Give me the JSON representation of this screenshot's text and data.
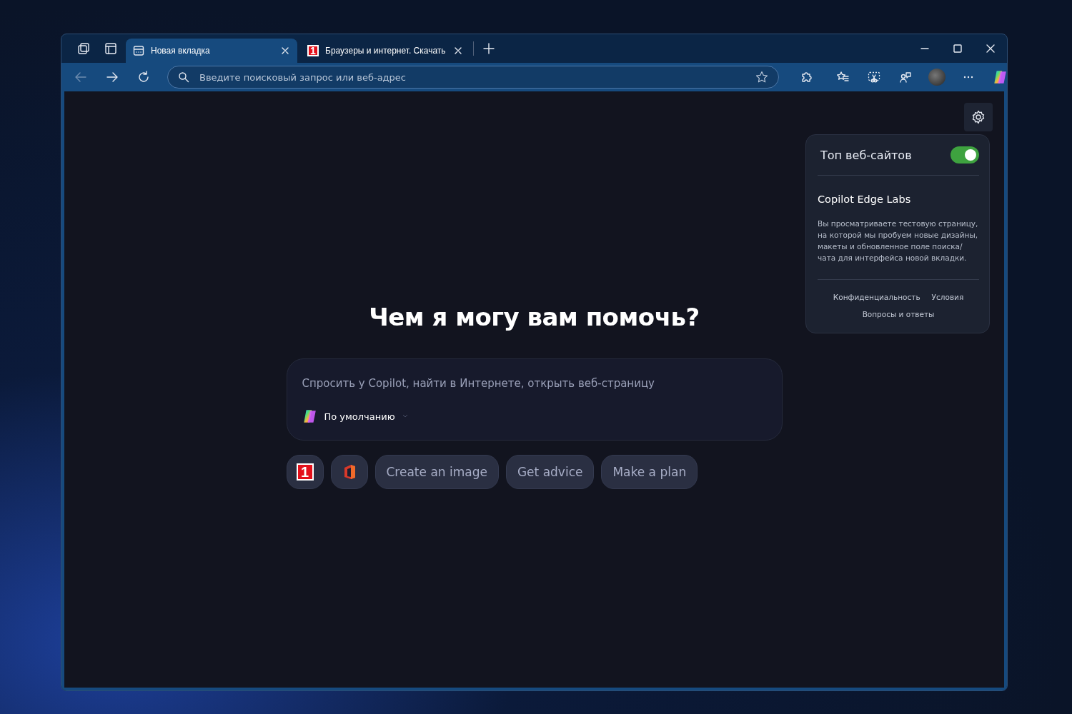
{
  "tabs": [
    {
      "kind": "newtab",
      "title": "Новая вкладка",
      "selected": true
    },
    {
      "kind": "site",
      "logo_text": "1",
      "title": "Браузеры и интернет. Скачать",
      "selected": false
    }
  ],
  "address_bar": {
    "placeholder": "Введите поисковый запрос или веб-адрес"
  },
  "heading": "Чем я могу вам помочь?",
  "chat_box": {
    "placeholder": "Спросить у Copilot, найти в Интернете, открыть веб-страницу",
    "mode": "По умолчанию"
  },
  "chips": [
    {
      "kind": "site",
      "logo_text": "1"
    },
    {
      "kind": "office"
    },
    {
      "kind": "text",
      "label": "Create an image"
    },
    {
      "kind": "text",
      "label": "Get advice"
    },
    {
      "kind": "text",
      "label": "Make a plan"
    }
  ],
  "panel": {
    "top_sites": {
      "label": "Топ веб-сайтов",
      "on": true
    },
    "title": "Copilot Edge Labs",
    "description": "Вы просматриваете тестовую страницу, на которой мы пробуем новые дизайны, макеты и обновленное поле поиска/чата для интерфейса новой вкладки.",
    "links": [
      "Конфиденциальность",
      "Условия",
      "Вопросы и ответы"
    ]
  }
}
